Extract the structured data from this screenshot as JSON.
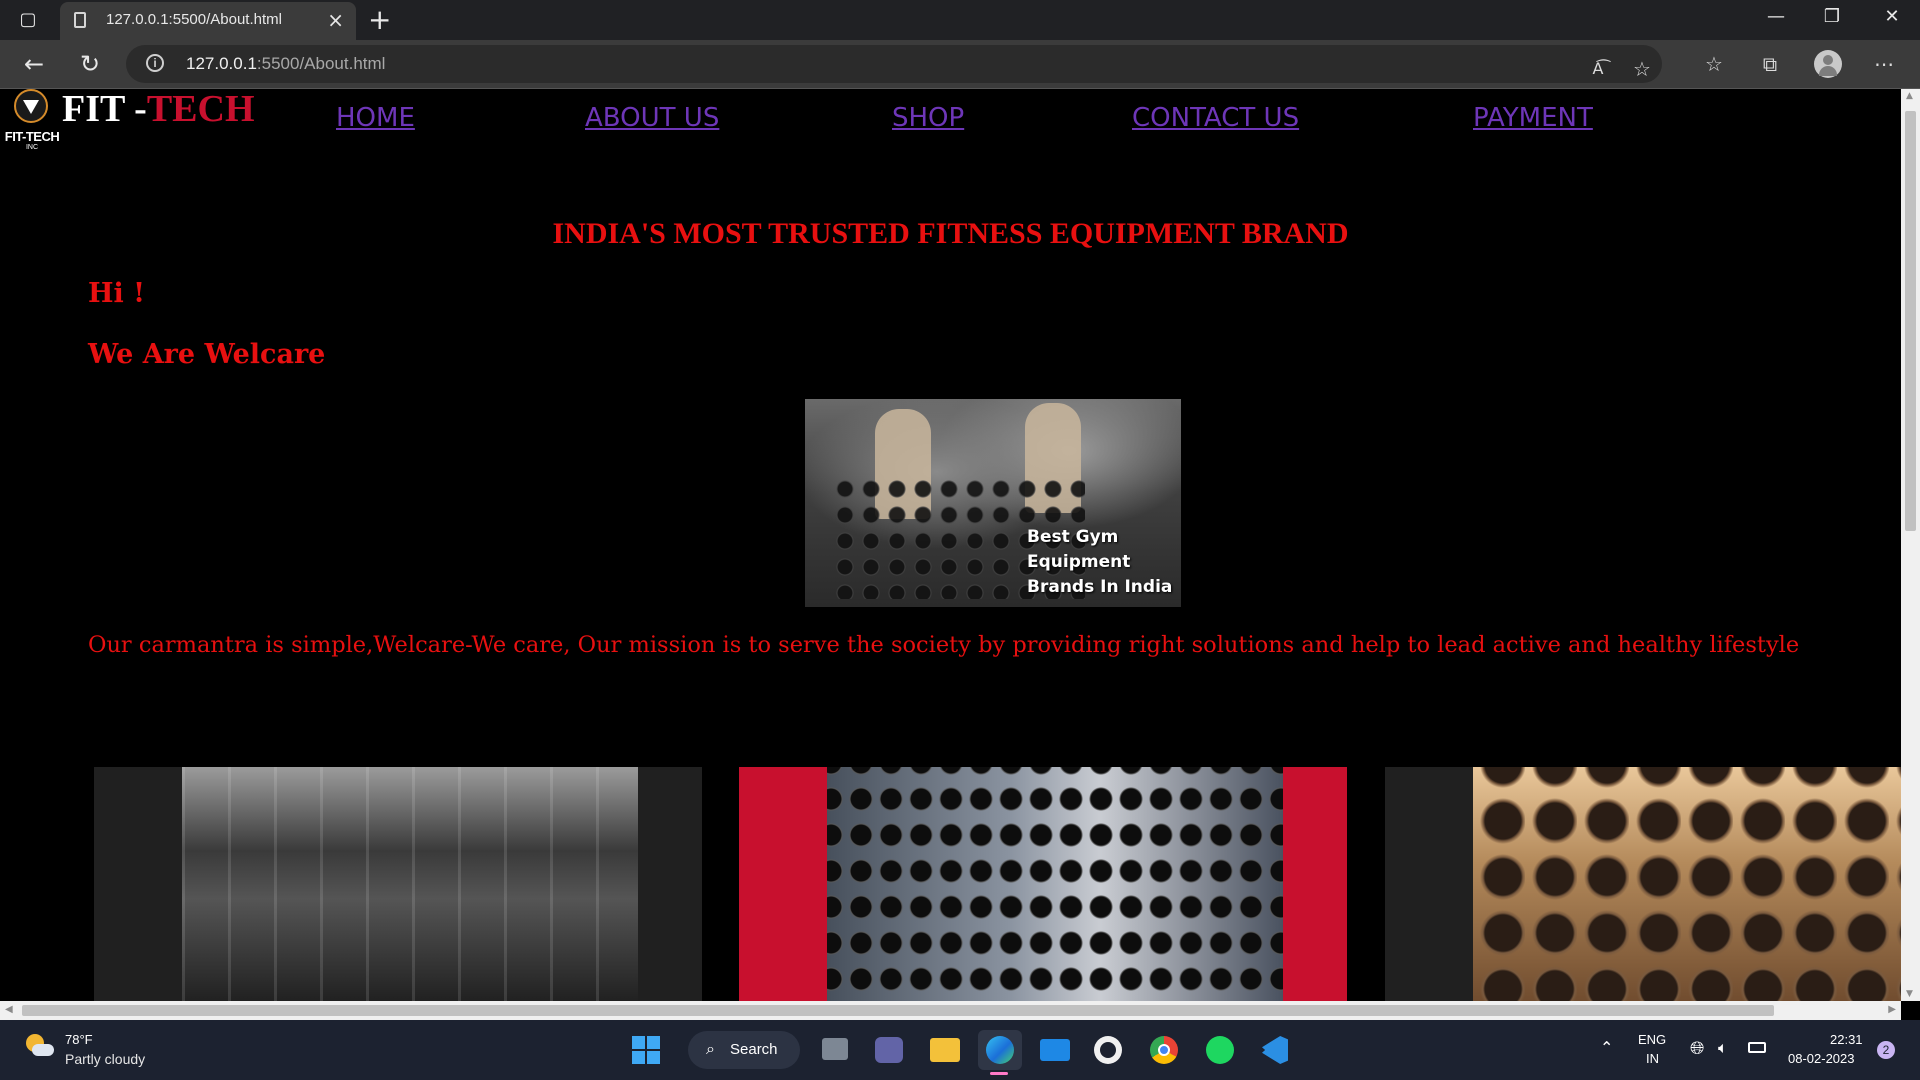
{
  "browser": {
    "tab_title": "127.0.0.1:5500/About.html",
    "url_host": "127.0.0.1",
    "url_path": ":5500/About.html"
  },
  "site": {
    "brand_part1": "FIT -",
    "brand_part2": "TECH",
    "logo_text": "FIT-TECH",
    "logo_subtext": "INC",
    "nav": [
      "HOME",
      "ABOUT US",
      "SHOP",
      "CONTACT US",
      "PAYMENT"
    ]
  },
  "content": {
    "headline": "INDIA'S MOST TRUSTED FITNESS EQUIPMENT BRAND",
    "greeting": "Hi !",
    "intro": "We Are Welcare",
    "hero_caption": "Best Gym Equipment Brands In India",
    "mission": "Our carmantra is simple,Welcare-We care, Our mission is to serve the society by providing right solutions and help to lead active and healthy lifestyle"
  },
  "taskbar": {
    "weather_temp": "78°F",
    "weather_desc": "Partly cloudy",
    "search_label": "Search",
    "lang_line1": "ENG",
    "lang_line2": "IN",
    "time": "22:31",
    "date": "08-02-2023",
    "notification_count": "2"
  },
  "colors": {
    "accent_red": "#e81010",
    "brand_red": "#c8102e",
    "nav_link": "#6e36b8",
    "page_bg": "#000000"
  }
}
